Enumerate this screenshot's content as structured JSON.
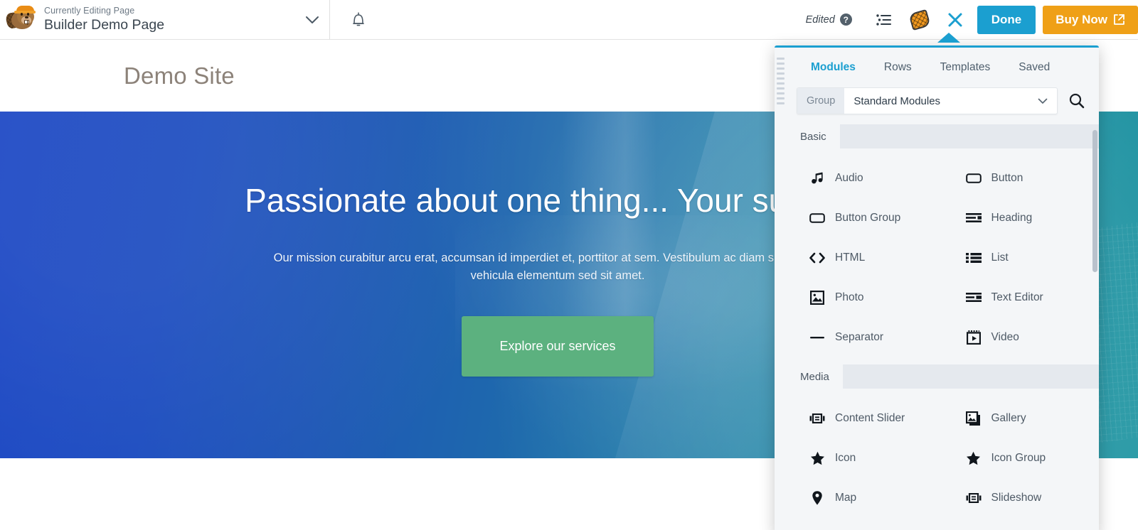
{
  "topbar": {
    "logo_icon": "beaver-logo",
    "eyebrow": "Currently Editing Page",
    "page_title": "Builder Demo Page",
    "caret_icon": "chevron-down-icon",
    "bell_icon": "notification-bell-icon",
    "edited_label": "Edited",
    "help_icon": "help-question-icon",
    "outline_icon": "outline-list-icon",
    "tools_icon": "beaver-tail-tools-icon",
    "close_icon": "close-x-icon",
    "done_label": "Done",
    "buy_label": "Buy Now",
    "external_link_icon": "external-link-icon",
    "colors": {
      "done_button": "#1b9fd0",
      "buy_button": "#efa017",
      "close_icon": "#1b9fd0"
    }
  },
  "page": {
    "site_title": "Demo Site",
    "hero": {
      "heading": "Passionate about one thing... Your success",
      "paragraph": "Our mission curabitur arcu erat, accumsan id imperdiet et, porttitor at sem. Vestibulum ac diam sit amet quam vehicula elementum sed sit amet.",
      "cta_label": "Explore our services",
      "cta_color": "#5cb17f",
      "bg_from": "#1b46c4",
      "bg_to": "#108e9b"
    }
  },
  "panel": {
    "grip_icon": "drag-handle-icon",
    "tabs": [
      {
        "label": "Modules",
        "active": true
      },
      {
        "label": "Rows",
        "active": false
      },
      {
        "label": "Templates",
        "active": false
      },
      {
        "label": "Saved",
        "active": false
      }
    ],
    "group_label": "Group",
    "group_value": "Standard Modules",
    "group_caret_icon": "chevron-down-icon",
    "search_icon": "search-icon",
    "sections": [
      {
        "title": "Basic",
        "modules": [
          {
            "label": "Audio",
            "icon": "music-note-icon"
          },
          {
            "label": "Button",
            "icon": "button-rect-icon"
          },
          {
            "label": "Button Group",
            "icon": "button-rect-icon"
          },
          {
            "label": "Heading",
            "icon": "heading-lines-icon"
          },
          {
            "label": "HTML",
            "icon": "code-brackets-icon"
          },
          {
            "label": "List",
            "icon": "bullet-list-icon"
          },
          {
            "label": "Photo",
            "icon": "photo-image-icon"
          },
          {
            "label": "Text Editor",
            "icon": "text-lines-icon"
          },
          {
            "label": "Separator",
            "icon": "horizontal-rule-icon"
          },
          {
            "label": "Video",
            "icon": "video-film-icon"
          }
        ]
      },
      {
        "title": "Media",
        "modules": [
          {
            "label": "Content Slider",
            "icon": "content-slider-icon"
          },
          {
            "label": "Gallery",
            "icon": "gallery-stack-icon"
          },
          {
            "label": "Icon",
            "icon": "star-icon"
          },
          {
            "label": "Icon Group",
            "icon": "star-icon"
          },
          {
            "label": "Map",
            "icon": "map-marker-icon"
          },
          {
            "label": "Slideshow",
            "icon": "content-slider-icon"
          }
        ]
      }
    ],
    "scrollbar": {
      "name": "panel-scrollbar"
    }
  }
}
